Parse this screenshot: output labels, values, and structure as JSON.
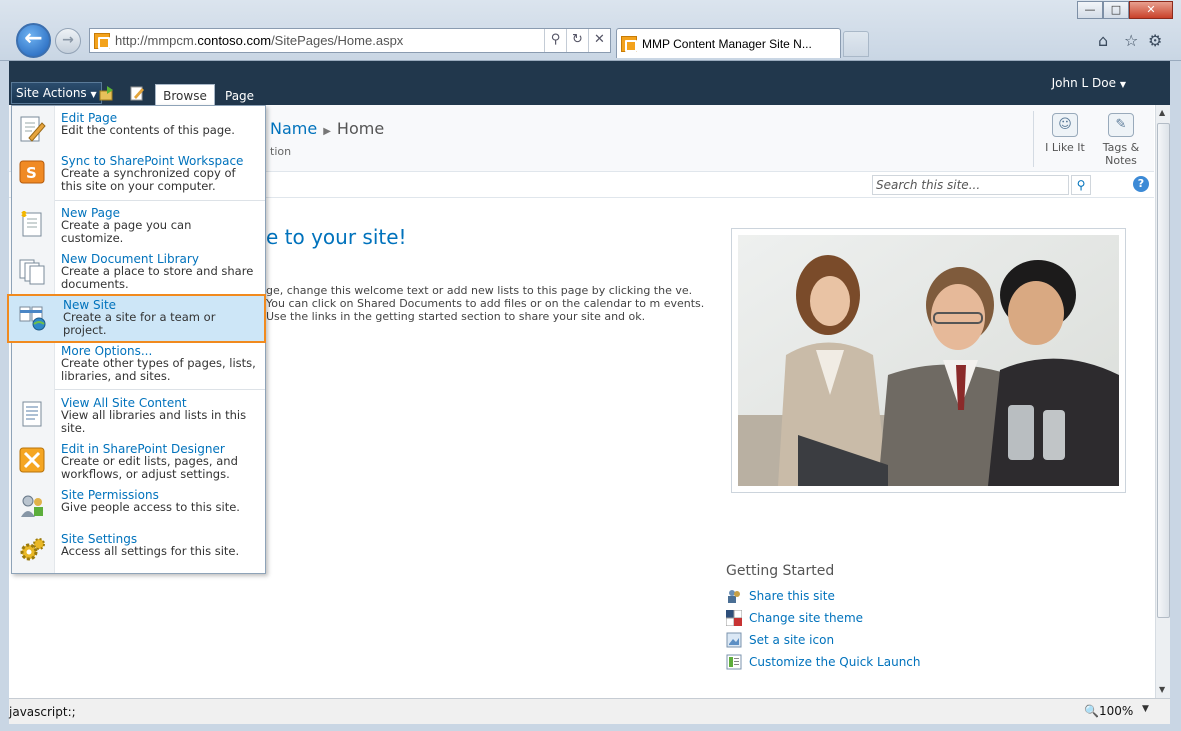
{
  "browser": {
    "url_prefix": "http://mmpcm.",
    "url_domain": "contoso.com",
    "url_path": "/SitePages/Home.aspx",
    "tab_title": "MMP Content Manager Site N...",
    "window_buttons": {
      "minimize": "—",
      "maximize": "□",
      "close": "✕"
    },
    "status_text": "javascript:;",
    "zoom": "100%"
  },
  "ribbon": {
    "site_actions_label": "Site Actions",
    "tab_browse": "Browse",
    "tab_page": "Page",
    "user": "John L Doe"
  },
  "header": {
    "crumb_site": "Name",
    "crumb_page": "Home",
    "description": "tion",
    "i_like_it": "I Like It",
    "tags_notes_1": "Tags &",
    "tags_notes_2": "Notes",
    "search_placeholder": "Search this site..."
  },
  "content": {
    "welcome": "e to your site!",
    "intro": "ge, change this welcome text or add new lists to this page by clicking the ve. You can click on Shared Documents to add files or on the calendar to m events. Use the links in the getting started section to share your site and ok."
  },
  "getting_started": {
    "title": "Getting Started",
    "links": [
      "Share this site",
      "Change site theme",
      "Set a site icon",
      "Customize the Quick Launch"
    ]
  },
  "menu": {
    "items": [
      {
        "title": "Edit Page",
        "desc": "Edit the contents of this page.",
        "icon": "edit-page-icon"
      },
      {
        "title": "Sync to SharePoint Workspace",
        "desc": "Create a synchronized copy of this site on your computer.",
        "icon": "sharepoint-workspace-icon"
      },
      {
        "title": "New Page",
        "desc": "Create a page you can customize.",
        "icon": "new-page-icon"
      },
      {
        "title": "New Document Library",
        "desc": "Create a place to store and share documents.",
        "icon": "document-library-icon"
      },
      {
        "title": "New Site",
        "desc": "Create a site for a team or project.",
        "icon": "new-site-icon"
      },
      {
        "title": "More Options...",
        "desc": "Create other types of pages, lists, libraries, and sites.",
        "icon": ""
      },
      {
        "title": "View All Site Content",
        "desc": "View all libraries and lists in this site.",
        "icon": "site-content-icon"
      },
      {
        "title": "Edit in SharePoint Designer",
        "desc": "Create or edit lists, pages, and workflows, or adjust settings.",
        "icon": "sharepoint-designer-icon"
      },
      {
        "title": "Site Permissions",
        "desc": "Give people access to this site.",
        "icon": "permissions-icon"
      },
      {
        "title": "Site Settings",
        "desc": "Access all settings for this site.",
        "icon": "settings-gear-icon"
      }
    ]
  }
}
